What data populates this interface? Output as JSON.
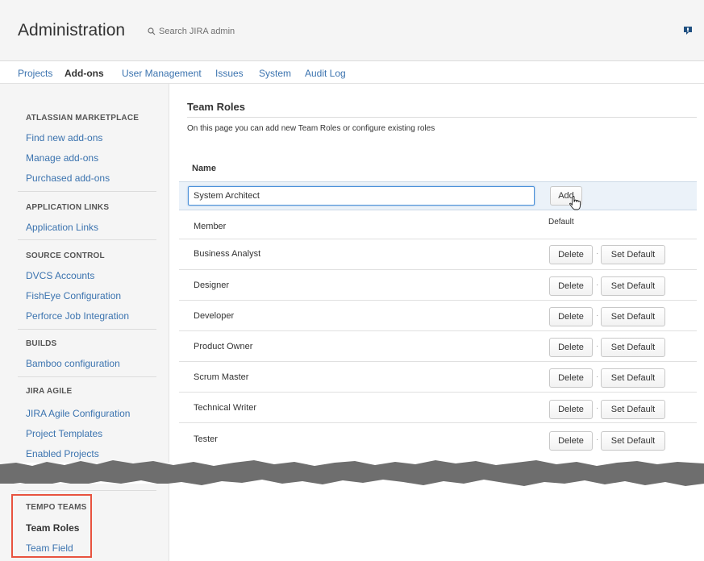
{
  "header": {
    "title": "Administration",
    "search_placeholder": "Search JIRA admin",
    "help_icon": "feedback-icon"
  },
  "nav": {
    "tabs": [
      {
        "label": "Projects",
        "active": false
      },
      {
        "label": "Add-ons",
        "active": true
      },
      {
        "label": "User Management",
        "active": false
      },
      {
        "label": "Issues",
        "active": false
      },
      {
        "label": "System",
        "active": false
      },
      {
        "label": "Audit Log",
        "active": false
      }
    ]
  },
  "sidebar": {
    "sections": [
      {
        "heading": "ATLASSIAN MARKETPLACE",
        "links": [
          "Find new add-ons",
          "Manage add-ons",
          "Purchased add-ons"
        ]
      },
      {
        "heading": "APPLICATION LINKS",
        "links": [
          "Application Links"
        ]
      },
      {
        "heading": "SOURCE CONTROL",
        "links": [
          "DVCS Accounts",
          "FishEye Configuration",
          "Perforce Job Integration"
        ]
      },
      {
        "heading": "BUILDS",
        "links": [
          "Bamboo configuration"
        ]
      },
      {
        "heading": "JIRA AGILE",
        "links": [
          "JIRA Agile Configuration",
          "Project Templates",
          "Enabled Projects"
        ]
      },
      {
        "heading": "TEMPO TEAMS",
        "links": [
          "Team Roles",
          "Team Field"
        ]
      }
    ]
  },
  "main": {
    "title": "Team Roles",
    "description": "On this page you can add new Team Roles or configure existing roles",
    "column_name": "Name",
    "new_role_value": "System Architect",
    "add_label": "Add",
    "default_label": "Default",
    "delete_label": "Delete",
    "set_default_label": "Set Default",
    "separator": "·",
    "roles": [
      "Member",
      "Business Analyst",
      "Designer",
      "Developer",
      "Product Owner",
      "Scrum Master",
      "Technical Writer",
      "Tester"
    ]
  },
  "colors": {
    "link": "#3b73af",
    "highlight_box": "#e8533f",
    "add_row_bg": "#ebf2f9"
  }
}
